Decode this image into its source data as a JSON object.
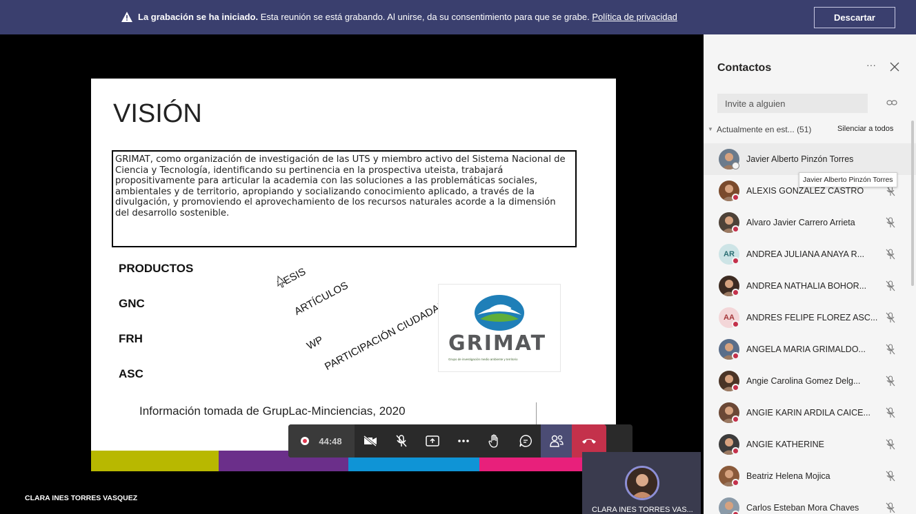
{
  "banner": {
    "bold": "La grabación se ha iniciado.",
    "text": "Esta reunión se está grabando. Al unirse, da su consentimiento para que se grabe.",
    "link": "Política de privacidad",
    "dismiss": "Descartar"
  },
  "slide": {
    "title": "VISIÓN",
    "vision_lines": [
      "GRIMAT, como organización de investigación de las UTS y miembro activo del Sistema Nacional de",
      "Ciencia y Tecnología, identificando su pertinencia en la prospectiva uteista, trabajará",
      "propositivamente para articular la academia con las soluciones a las problemáticas sociales,",
      "ambientales y de territorio, apropiando y socializando conocimiento aplicado, a través de la",
      "divulgación, y promoviendo el aprovechamiento de los recursos naturales acorde a la dimensión",
      "del desarrollo sostenible."
    ],
    "labels": {
      "productos": "PRODUCTOS",
      "gnc": "GNC",
      "frh": "FRH",
      "asc": "ASC"
    },
    "rotated": {
      "tesis": "TESIS",
      "articulos": "ARTÍCULOS",
      "wp": "WP",
      "participacion": "PARTICIPACIÓN CIUDADANA"
    },
    "logo_word": "GRIMAT",
    "logo_sub": "Grupo de investigación medio ambiente y territorio",
    "source": "Información tomada de GrupLac-Minciencias, 2020"
  },
  "controls": {
    "timer": "44:48",
    "buttons": [
      "camera-off",
      "mic-off",
      "share",
      "more",
      "raise-hand",
      "chat",
      "participants",
      "hang-up"
    ]
  },
  "stage": {
    "bottom_name": "CLARA INES TORRES VASQUEZ",
    "self_name": "CLARA INES TORRES VAS..."
  },
  "panel": {
    "title": "Contactos",
    "more": "···",
    "invite_placeholder": "Invite a alguien",
    "section_label": "Actualmente en est... (51)",
    "mute_all": "Silenciar a todos",
    "tooltip": "Javier Alberto Pinzón Torres",
    "participants": [
      {
        "name": "Javier Alberto Pinzón Torres",
        "initials": "",
        "avatar_color": "#6b7b8c",
        "status": "away",
        "muted": false
      },
      {
        "name": "ALEXIS GONZALEZ CASTRO",
        "initials": "",
        "avatar_color": "#7a4a2c",
        "status": "busy",
        "muted": true
      },
      {
        "name": "Alvaro Javier Carrero Arrieta",
        "initials": "",
        "avatar_color": "#4d4238",
        "status": "busy",
        "muted": true
      },
      {
        "name": "ANDREA JULIANA ANAYA R...",
        "initials": "AR",
        "avatar_color": "#cde4e6",
        "status": "busy",
        "muted": true
      },
      {
        "name": "ANDREA NATHALIA BOHOR...",
        "initials": "",
        "avatar_color": "#3d2b22",
        "status": "busy",
        "muted": true
      },
      {
        "name": "ANDRES FELIPE FLOREZ ASC...",
        "initials": "AA",
        "avatar_color": "#f3d6d8",
        "status": "busy",
        "muted": true
      },
      {
        "name": "ANGELA MARIA GRIMALDO...",
        "initials": "",
        "avatar_color": "#5a6e8a",
        "status": "busy",
        "muted": true
      },
      {
        "name": "Angie Carolina Gomez Delg...",
        "initials": "",
        "avatar_color": "#4a3426",
        "status": "busy",
        "muted": true
      },
      {
        "name": "ANGIE KARIN ARDILA CAICE...",
        "initials": "",
        "avatar_color": "#6b4836",
        "status": "busy",
        "muted": true
      },
      {
        "name": "ANGIE KATHERINE",
        "initials": "",
        "avatar_color": "#3c3c3c",
        "status": "busy",
        "muted": true
      },
      {
        "name": "Beatriz Helena Mojica",
        "initials": "",
        "avatar_color": "#8a5a3a",
        "status": "busy",
        "muted": true
      },
      {
        "name": "Carlos Esteban Mora Chaves",
        "initials": "",
        "avatar_color": "#8a9aa8",
        "status": "busy",
        "muted": true
      }
    ]
  },
  "colors": {
    "banner": "#3a3f6e",
    "accent": "#4b4c74",
    "hangup": "#c4314b",
    "panel": "#f5f5f5"
  }
}
